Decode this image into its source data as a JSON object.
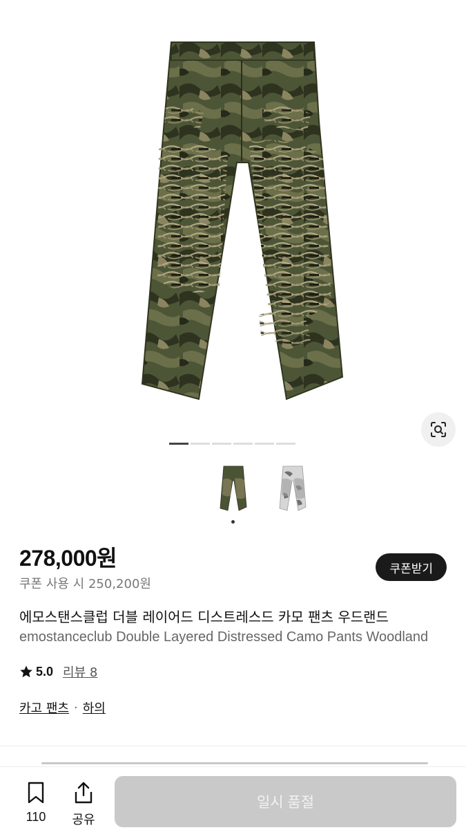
{
  "gallery": {
    "page_count": 6,
    "active_page": 1,
    "thumbnails": [
      "camo-dark",
      "camo-light"
    ],
    "selected_thumbnail": 1
  },
  "product": {
    "price": "278,000원",
    "coupon_price": "쿠폰 사용 시 250,200원",
    "coupon_button": "쿠폰받기",
    "title_ko": "에모스탠스클럽 더블 레이어드 디스트레스드 카모 팬츠 우드랜드",
    "title_en": "emostanceclub Double Layered Distressed Camo Pants Woodland",
    "rating": "5.0",
    "review_label": "리뷰 8",
    "categories": [
      "카고 팬츠",
      "하의"
    ],
    "category_sep": "·"
  },
  "bottom_bar": {
    "bookmark_count": "110",
    "share_label": "공유",
    "action_label": "일시 품절"
  },
  "colors": {
    "accent_dark": "#1a1a1a",
    "disabled_button": "#c9c9c9",
    "camo_base": "#4a5236"
  }
}
